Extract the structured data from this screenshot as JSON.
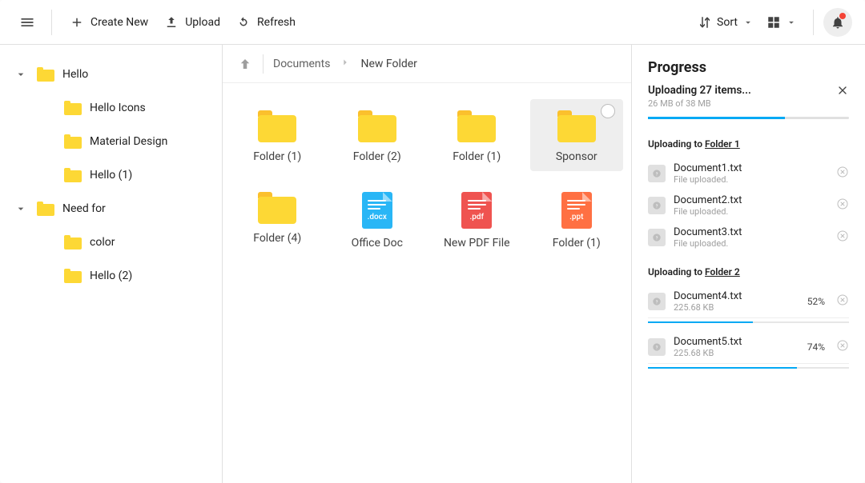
{
  "toolbar": {
    "create_label": "Create New",
    "upload_label": "Upload",
    "refresh_label": "Refresh",
    "sort_label": "Sort"
  },
  "sidebar": {
    "items": [
      {
        "label": "Hello",
        "expandable": true,
        "indent": 0
      },
      {
        "label": "Hello Icons",
        "expandable": false,
        "indent": 1
      },
      {
        "label": "Material Design",
        "expandable": false,
        "indent": 1
      },
      {
        "label": "Hello (1)",
        "expandable": false,
        "indent": 1
      },
      {
        "label": "Need for",
        "expandable": true,
        "indent": 0
      },
      {
        "label": "color",
        "expandable": false,
        "indent": 1
      },
      {
        "label": "Hello (2)",
        "expandable": false,
        "indent": 1
      }
    ]
  },
  "breadcrumb": {
    "items": [
      {
        "label": "Documents"
      },
      {
        "label": "New Folder"
      }
    ]
  },
  "grid": {
    "items": [
      {
        "type": "folder",
        "label": "Folder (1)"
      },
      {
        "type": "folder",
        "label": "Folder (2)"
      },
      {
        "type": "folder",
        "label": "Folder (1)"
      },
      {
        "type": "folder",
        "label": "Sponsor",
        "selected": true
      },
      {
        "type": "folder",
        "label": "Folder (4)"
      },
      {
        "type": "docx",
        "label": "Office Doc",
        "ext": ".docx"
      },
      {
        "type": "pdf",
        "label": "New PDF File",
        "ext": ".pdf"
      },
      {
        "type": "ppt",
        "label": "Folder (1)",
        "ext": ".ppt"
      }
    ]
  },
  "progress": {
    "title": "Progress",
    "summary": "Uploading 27 items...",
    "summary_sub": "26 MB of 38 MB",
    "overall_pct": 68,
    "groups": [
      {
        "prefix": "Uploading to ",
        "target": "Folder 1",
        "files": [
          {
            "name": "Document1.txt",
            "sub": "File uploaded.",
            "pct": null
          },
          {
            "name": "Document2.txt",
            "sub": "File uploaded.",
            "pct": null
          },
          {
            "name": "Document3.txt",
            "sub": "File uploaded.",
            "pct": null
          }
        ]
      },
      {
        "prefix": "Uploading to ",
        "target": "Folder 2",
        "files": [
          {
            "name": "Document4.txt",
            "sub": "225.68 KB",
            "pct": 52
          },
          {
            "name": "Document5.txt",
            "sub": "225.68 KB",
            "pct": 74
          }
        ]
      }
    ]
  }
}
